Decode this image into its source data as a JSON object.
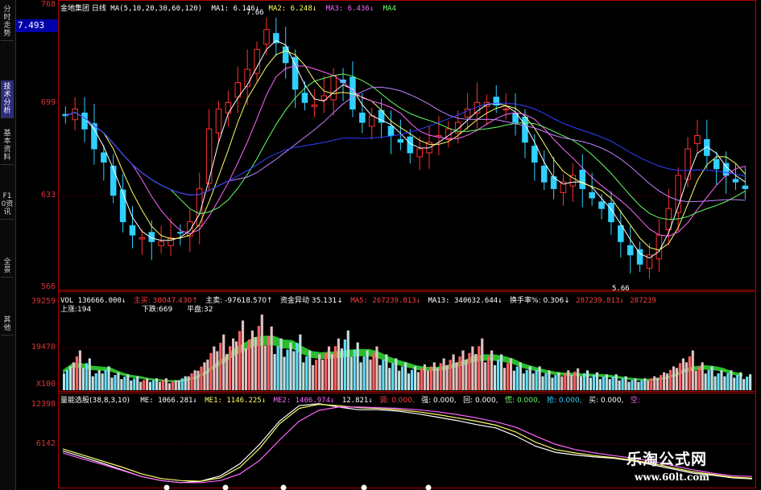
{
  "sidebar": [
    "分时走势",
    "技术分析",
    "基本资料",
    "F10资讯",
    "全景",
    "其他"
  ],
  "sidebar_active": 1,
  "price_axis": {
    "top": "768",
    "a": "699",
    "b": "633",
    "bottom": "566",
    "current": "7.493"
  },
  "vol_axis": {
    "top": "39259",
    "mid": "19470",
    "unit": "X100"
  },
  "macd_axis": {
    "top": "12398",
    "mid": "6142"
  },
  "header": {
    "title": "金地集团 日线",
    "ma_params": "MA(5,10,20,30,60,120)",
    "ma1": "MA1: 6.146↓",
    "ma2": "MA2: 6.248↓",
    "ma3": "MA3: 6.436↓",
    "ma4": "MA4"
  },
  "hi_marker": "7.66",
  "lo_marker": "5.66",
  "vol_header": {
    "vol": "VOL 136666.000↓",
    "zhuliu": "主买: 38047.430↑",
    "zhumai": "主卖: -97618.570↑",
    "flow": "资金异动 35.131↓",
    "ma5": "MA5: 267239.813↓",
    "ma13": "MA13: 340632.644↓",
    "turnover": "换手率%: 0.306↓",
    "v2": "287239.813↓",
    "v3": "287239"
  },
  "vol_sub": {
    "up": "上涨:194",
    "down": "下跌:669",
    "flat": "平盘:32"
  },
  "ind_header": {
    "name": "量能选股(38,8,3,10)",
    "me": "ME: 1066.281↓",
    "me1": "ME1: 1146.225↓",
    "me2": "ME2: 1406.974↓",
    "v4": "12.821↓",
    "s1": "调: 0.000,",
    "s2": "强: 0.000,",
    "s3": "回: 0.000,",
    "s4": "慌: 0.000,",
    "s5": "抢: 0.000,",
    "s6": "买: 0.000,",
    "s7": "买: 0.000,",
    "s8": "空:"
  },
  "watermark": {
    "cn": "乐淘公式网",
    "url": "www.60lt.com"
  },
  "colors": {
    "up": "#ff3030",
    "down": "#30d0ff",
    "ma1": "#ffffff",
    "ma2": "#ffff66",
    "ma3": "#ff66ff",
    "ma4": "#66ff66",
    "ma5": "#c080ff",
    "ma6": "#3040ff"
  },
  "chart_data": [
    {
      "type": "candlestick",
      "title": "金地集团 日线",
      "ylim": [
        5.6,
        7.7
      ],
      "ticks": [
        7.68,
        6.99,
        6.33,
        5.66
      ],
      "close": [
        6.9,
        6.95,
        6.8,
        6.65,
        6.55,
        6.3,
        6.1,
        6.0,
        5.98,
        5.95,
        5.95,
        5.98,
        6.02,
        6.1,
        6.35,
        6.8,
        6.95,
        7.0,
        7.15,
        7.25,
        7.4,
        7.55,
        7.45,
        7.3,
        7.1,
        7.0,
        6.98,
        7.05,
        7.2,
        7.15,
        6.95,
        6.85,
        6.9,
        6.85,
        6.75,
        6.7,
        6.62,
        6.65,
        6.7,
        6.75,
        6.8,
        6.85,
        6.95,
        7.0,
        7.0,
        6.98,
        6.95,
        6.85,
        6.7,
        6.55,
        6.4,
        6.35,
        6.4,
        6.45,
        6.35,
        6.28,
        6.2,
        6.1,
        5.95,
        5.85,
        5.78,
        5.85,
        6.0,
        6.2,
        6.45,
        6.65,
        6.75,
        6.6,
        6.5,
        6.45,
        6.4,
        6.35
      ]
    },
    {
      "type": "bar",
      "series": [
        {
          "name": "VOL",
          "values": [
            12,
            20,
            16,
            10,
            12,
            9,
            8,
            7,
            6,
            6,
            6,
            5,
            7,
            10,
            14,
            22,
            28,
            26,
            35,
            30,
            38,
            32,
            26,
            24,
            28,
            20,
            18,
            22,
            26,
            30,
            24,
            20,
            22,
            18,
            16,
            14,
            12,
            13,
            14,
            16,
            18,
            20,
            22,
            26,
            20,
            18,
            16,
            14,
            12,
            12,
            10,
            9,
            10,
            11,
            10,
            9,
            8,
            8,
            7,
            6,
            6,
            7,
            9,
            12,
            16,
            20,
            14,
            12,
            10,
            10,
            9,
            8
          ]
        }
      ],
      "ylim": [
        0,
        39259
      ]
    },
    {
      "type": "line",
      "series": [
        {
          "name": "ME",
          "values": [
            5200,
            4300,
            3400,
            2400,
            1400,
            800,
            500,
            700,
            1500,
            3300,
            6200,
            9600,
            11900,
            12200,
            11700,
            11300,
            11300,
            11100,
            10700,
            10200,
            9700,
            9100,
            8600,
            7400,
            5900,
            5000,
            4600,
            4300,
            4100,
            3700,
            3100,
            2500,
            1900,
            1600,
            1200,
            1066
          ]
        },
        {
          "name": "ME1",
          "values": [
            5500,
            4600,
            3700,
            2800,
            1800,
            1100,
            800,
            700,
            1200,
            2800,
            5600,
            9200,
            11500,
            12100,
            11900,
            11600,
            11500,
            11300,
            11000,
            10600,
            10100,
            9600,
            9000,
            8000,
            6500,
            5400,
            4900,
            4500,
            4200,
            3800,
            3300,
            2700,
            2100,
            1700,
            1300,
            1146
          ]
        },
        {
          "name": "ME2",
          "values": [
            4900,
            4000,
            3200,
            2300,
            1400,
            800,
            500,
            500,
            800,
            1800,
            3800,
            6800,
            9600,
            11200,
            11700,
            11700,
            11600,
            11500,
            11300,
            11000,
            10600,
            10100,
            9500,
            8700,
            7400,
            6200,
            5400,
            4900,
            4500,
            4100,
            3600,
            3000,
            2400,
            1900,
            1500,
            1407
          ]
        }
      ],
      "ylim": [
        0,
        12398
      ]
    }
  ]
}
